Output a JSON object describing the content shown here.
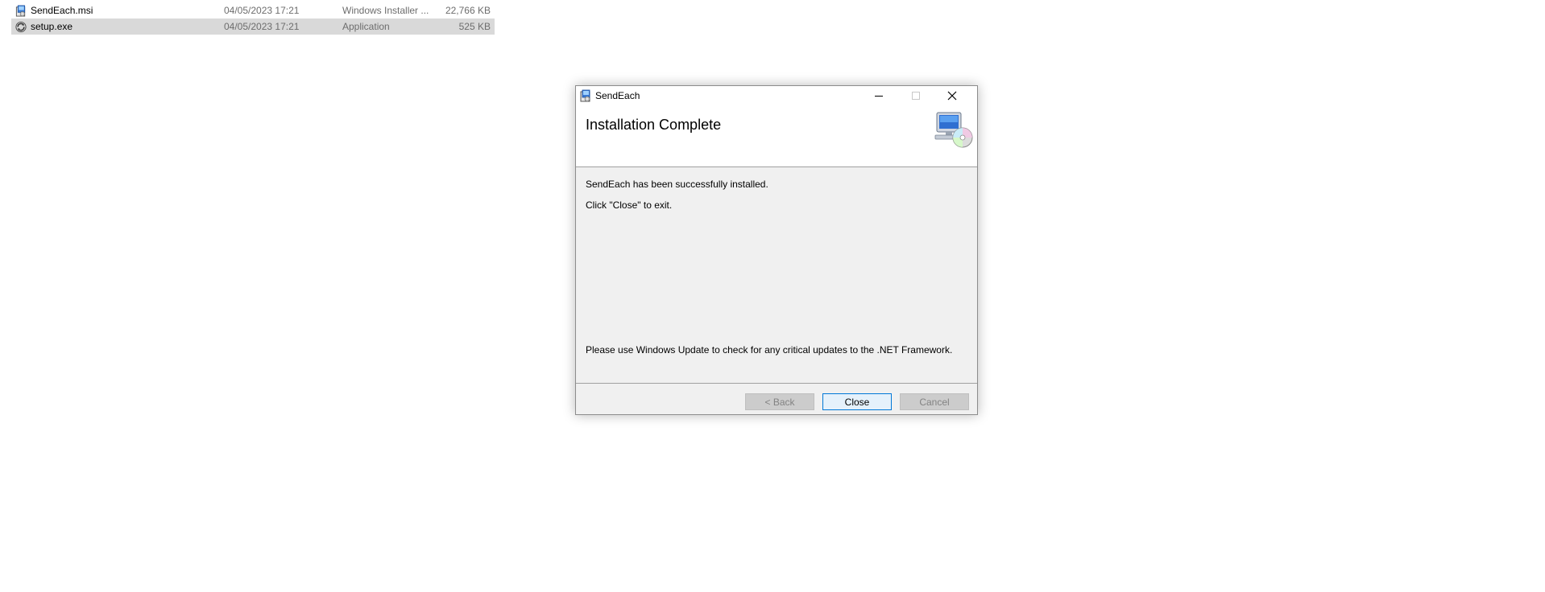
{
  "explorer": {
    "files": [
      {
        "name": "SendEach.msi",
        "date": "04/05/2023 17:21",
        "type": "Windows Installer ...",
        "size": "22,766 KB",
        "icon": "msi-installer-icon",
        "selected": false
      },
      {
        "name": "setup.exe",
        "date": "04/05/2023 17:21",
        "type": "Application",
        "size": "525 KB",
        "icon": "setup-exe-icon",
        "selected": true
      }
    ]
  },
  "dialog": {
    "title": "SendEach",
    "title_icon": "installer-app-icon",
    "window_controls": [
      "minimize-icon",
      "maximize-icon",
      "close-icon"
    ],
    "header_title": "Installation Complete",
    "header_graphic": "computer-cd-icon",
    "messages": {
      "success": "SendEach has been successfully installed.",
      "exit_hint": "Click \"Close\" to exit.",
      "update_note": "Please use Windows Update to check for any critical updates to the .NET Framework."
    },
    "buttons": {
      "back": "< Back",
      "close": "Close",
      "cancel": "Cancel"
    },
    "colors": {
      "accent": "#0078d7",
      "panel": "#f0f0f0",
      "selected_row": "#d9d9d9"
    }
  }
}
